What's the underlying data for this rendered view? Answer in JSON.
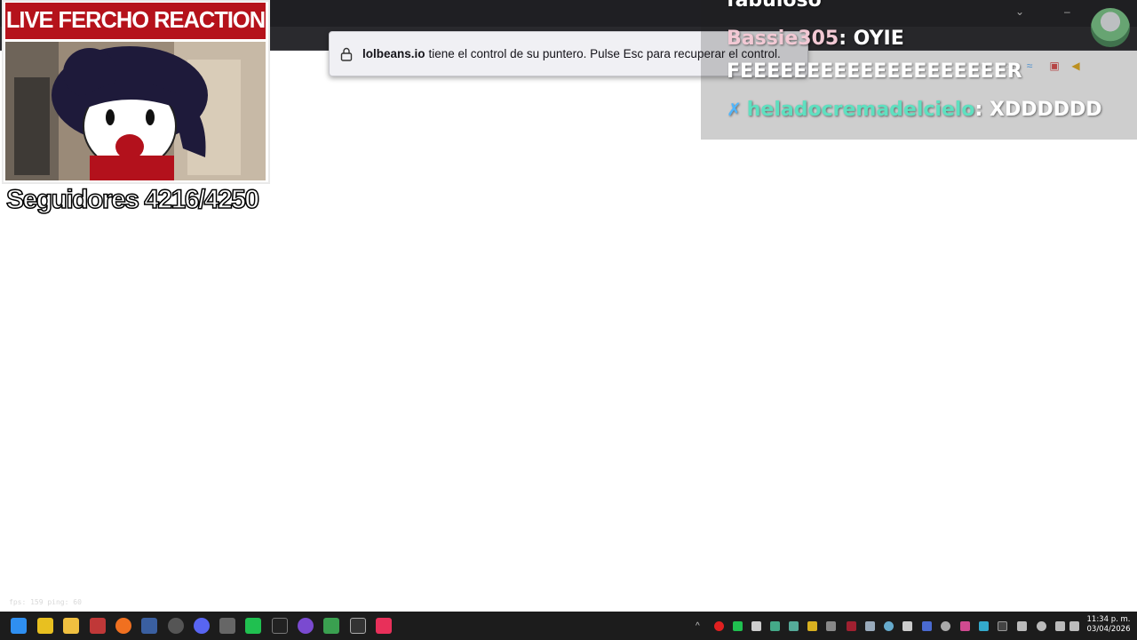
{
  "notification": {
    "domain": "lolbeans.io",
    "message": "tiene el control de su puntero. Pulse Esc para recuperar el control."
  },
  "chat": {
    "lines": [
      {
        "user": "",
        "text": "fabuloso"
      },
      {
        "user": "Bassie305",
        "text": ": OYIE"
      },
      {
        "user": "",
        "text": "FEEEEEEEEEEEEEEEEEEEER"
      },
      {
        "user": "heladocremadelcielo",
        "text": ": XDDDDDD"
      }
    ]
  },
  "stream": {
    "title": "LIVE FERCHO REACTION",
    "followers": "Seguidores 4216/4250",
    "debug": "fps: 159 ping: 60"
  },
  "taskbar": {
    "clock_time": "11:34 p. m.",
    "clock_date": "03/04/2026"
  },
  "colors": {
    "title_red": "#b5121b",
    "chat_pink": "#f2c9d4",
    "chat_teal": "#5fe0c0"
  }
}
